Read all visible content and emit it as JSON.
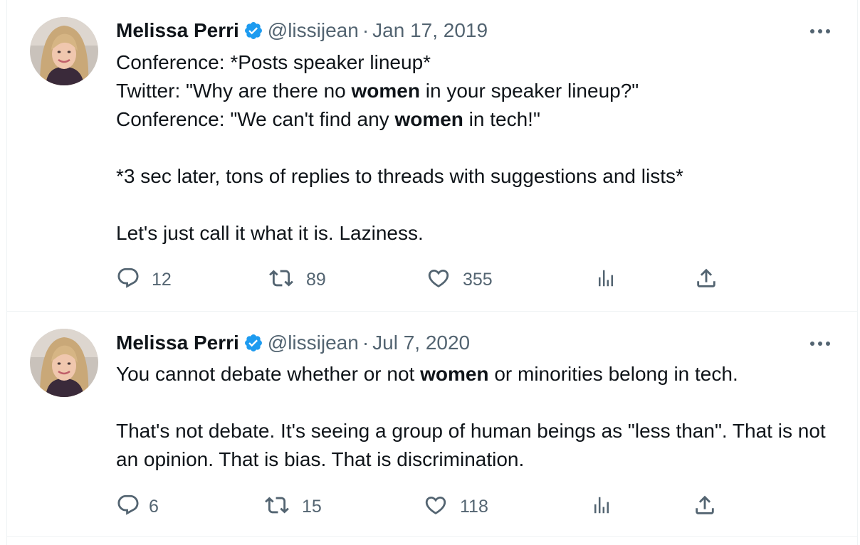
{
  "tweets": [
    {
      "author": {
        "name": "Melissa Perri",
        "handle": "@lissijean",
        "verified": true
      },
      "separator": "·",
      "date": "Jan 17, 2019",
      "segments": {
        "l1": "Conference: *Posts speaker lineup*",
        "l2a": "Twitter: \"Why are there no ",
        "l2b": "women",
        "l2c": " in your speaker lineup?\"",
        "l3a": "Conference: \"We can't find any ",
        "l3b": "women",
        "l3c": " in tech!\"",
        "l4": "*3 sec later, tons of replies to threads with suggestions and lists*",
        "l5": "Let's just call it what it is. Laziness."
      },
      "stats": {
        "replies": "12",
        "retweets": "89",
        "likes": "355"
      }
    },
    {
      "author": {
        "name": "Melissa Perri",
        "handle": "@lissijean",
        "verified": true
      },
      "separator": "·",
      "date": "Jul 7, 2020",
      "segments": {
        "l1a": "You cannot debate whether or not ",
        "l1b": "women",
        "l1c": " or minorities belong in tech.",
        "l2": "That's not debate. It's seeing a group of human beings as \"less than\". That is not an opinion. That is bias. That is discrimination."
      },
      "stats": {
        "replies": "6",
        "retweets": "15",
        "likes": "118"
      }
    }
  ],
  "colors": {
    "text": "#0f1419",
    "secondary": "#536471",
    "verified": "#1d9bf0",
    "border": "#eff3f4"
  },
  "icons": [
    "verified-badge-icon",
    "more-icon",
    "reply-icon",
    "retweet-icon",
    "like-icon",
    "views-icon",
    "share-icon"
  ]
}
